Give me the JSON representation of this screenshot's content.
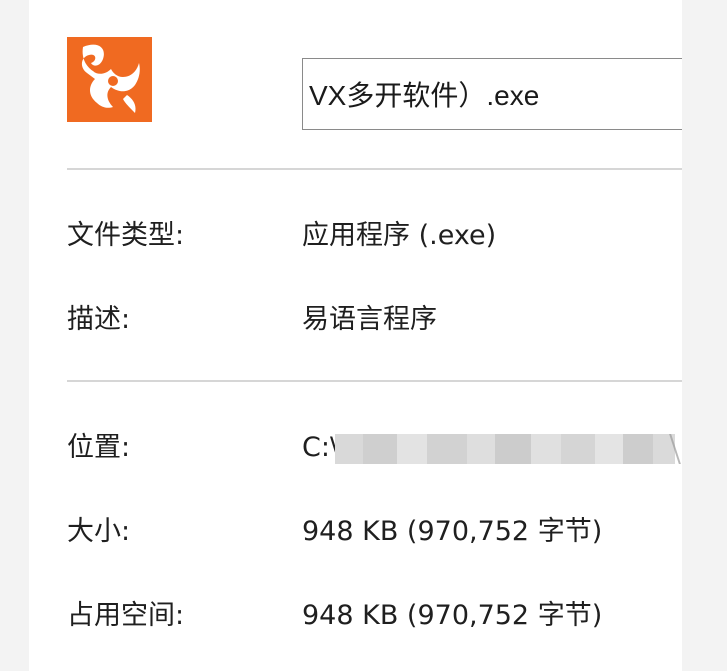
{
  "file": {
    "name_value": "VX多开软件）.exe",
    "icon": "app-logo-icon",
    "icon_color": "#f06a21"
  },
  "properties": {
    "type_label": "文件类型:",
    "type_value": "应用程序 (.exe)",
    "description_label": "描述:",
    "description_value": "易语言程序",
    "location_label": "位置:",
    "location_value_visible": "C:\\",
    "size_label": "大小:",
    "size_value": "948 KB (970,752 字节)",
    "size_on_disk_label": "占用空间:",
    "size_on_disk_value": "948 KB (970,752 字节)"
  },
  "colors": {
    "panel_background": "#ffffff",
    "page_background": "#f3f3f3",
    "divider": "#d6d6d6",
    "field_border": "#8a8a8a"
  }
}
